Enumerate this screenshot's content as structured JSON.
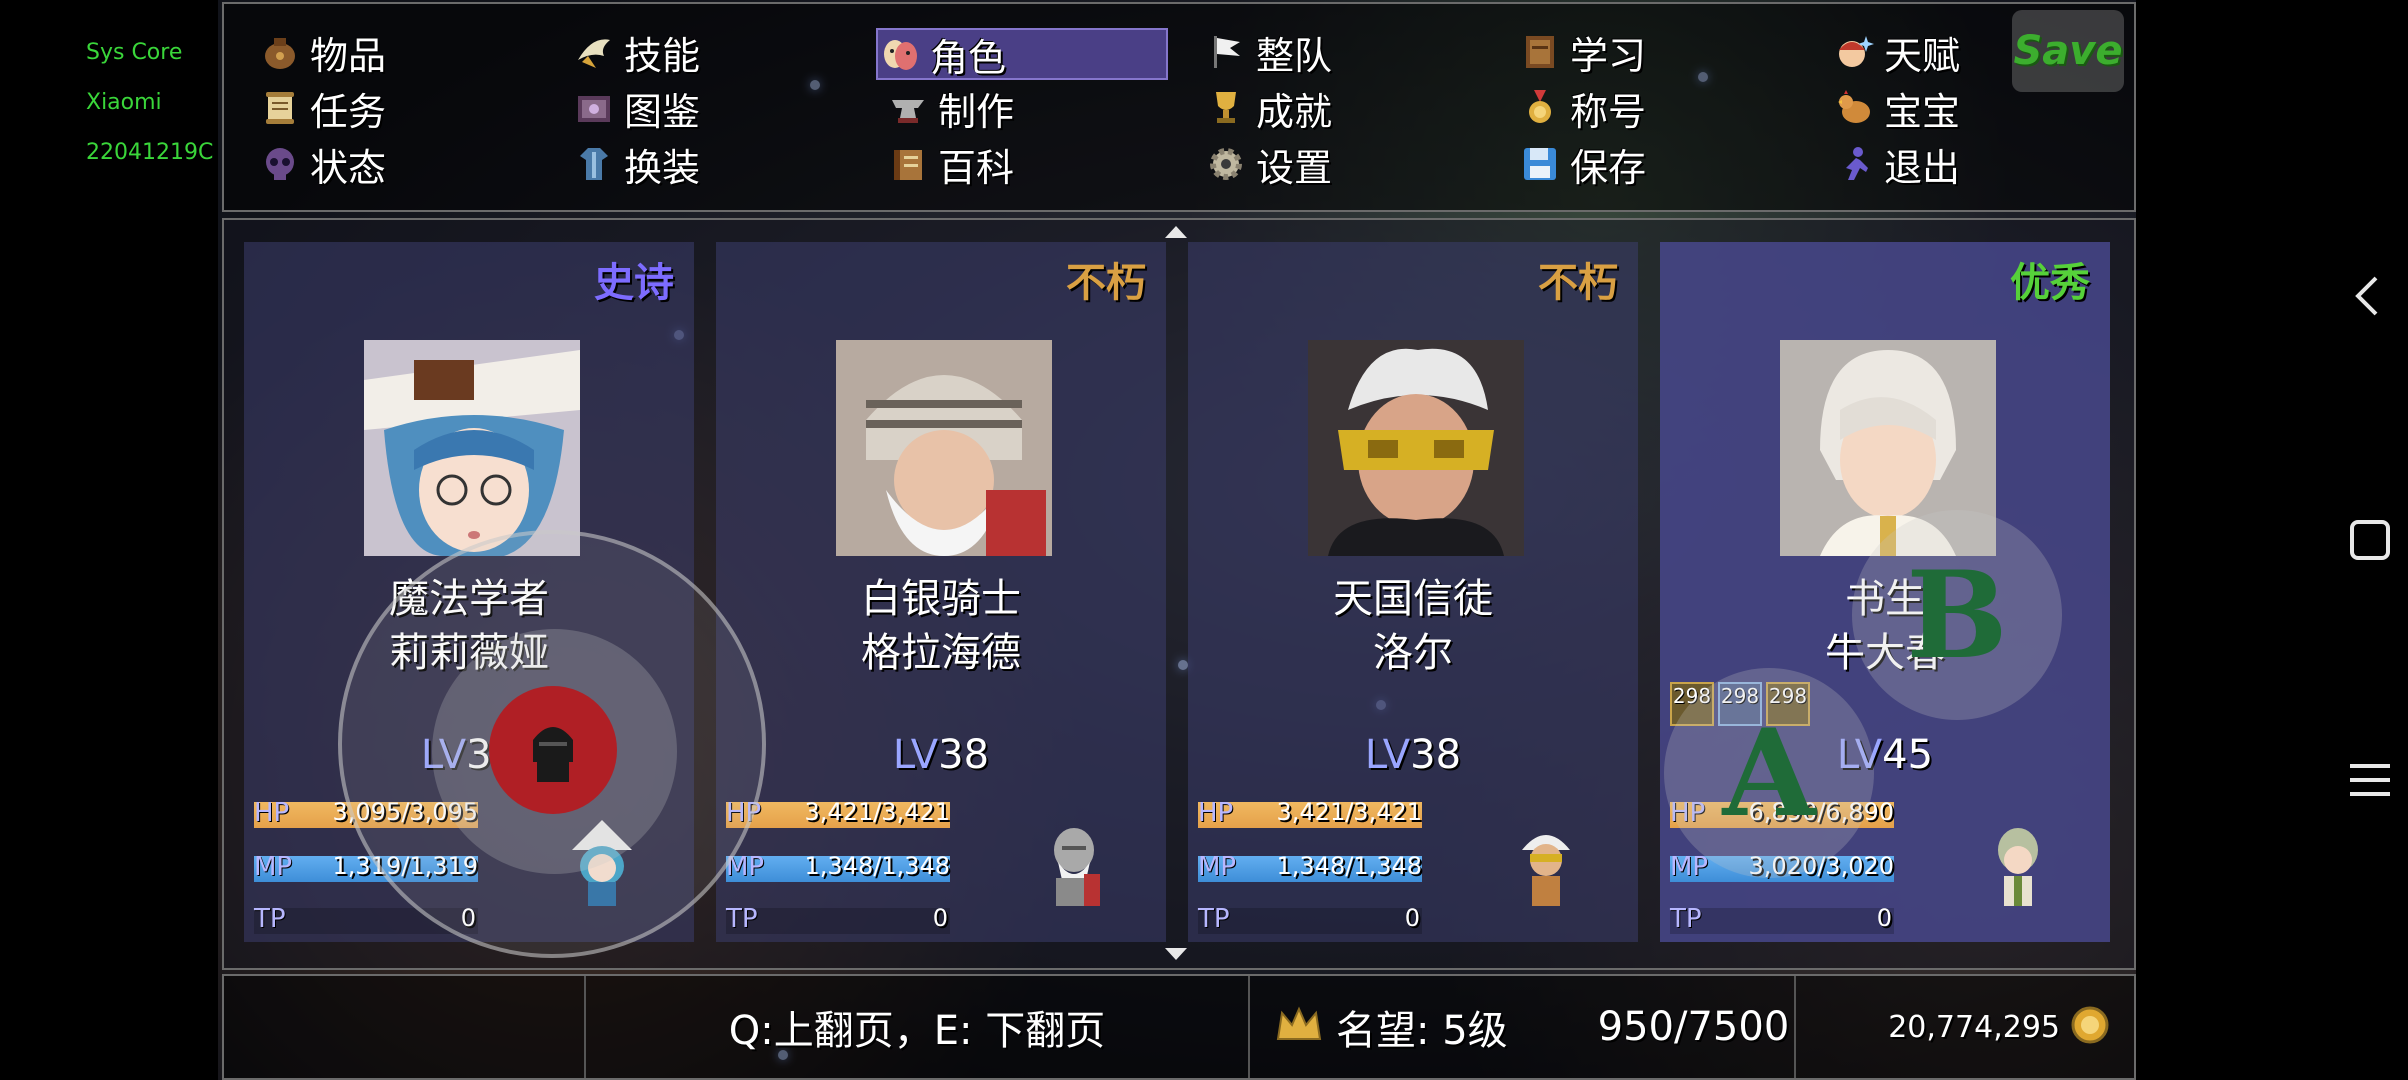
{
  "system_overlay": [
    "Sys Core",
    "Xiaomi",
    "22041219C"
  ],
  "menu": {
    "items": [
      {
        "label": "物品",
        "icon": "bag-icon"
      },
      {
        "label": "技能",
        "icon": "skill-wing-icon"
      },
      {
        "label": "角色",
        "icon": "mask-icon"
      },
      {
        "label": "整队",
        "icon": "flag-icon"
      },
      {
        "label": "学习",
        "icon": "book-icon"
      },
      {
        "label": "天赋",
        "icon": "talent-face-icon"
      },
      {
        "label": "任务",
        "icon": "scroll-icon"
      },
      {
        "label": "图鉴",
        "icon": "catalog-book-icon"
      },
      {
        "label": "制作",
        "icon": "anvil-icon"
      },
      {
        "label": "成就",
        "icon": "trophy-icon"
      },
      {
        "label": "称号",
        "icon": "medal-icon"
      },
      {
        "label": "宝宝",
        "icon": "chicken-icon"
      },
      {
        "label": "状态",
        "icon": "skull-icon"
      },
      {
        "label": "换装",
        "icon": "outfit-icon"
      },
      {
        "label": "百科",
        "icon": "encyclopedia-icon"
      },
      {
        "label": "设置",
        "icon": "gear-icon"
      },
      {
        "label": "保存",
        "icon": "floppy-disk-icon"
      },
      {
        "label": "退出",
        "icon": "exit-runner-icon"
      }
    ],
    "active_index": 2,
    "save_button": "Save"
  },
  "characters": [
    {
      "rarity": "史诗",
      "rarity_color": "#7d6cff",
      "class": "魔法学者",
      "name": "莉莉薇娅",
      "level_prefix": "LV",
      "level": "30",
      "hp": "3,095/3,095",
      "hp_pct": 100,
      "mp": "1,319/1,319",
      "mp_pct": 100,
      "tp": "0",
      "tp_pct": 0,
      "badges": []
    },
    {
      "rarity": "不朽",
      "rarity_color": "#d9a043",
      "class": "白银骑士",
      "name": "格拉海德",
      "level_prefix": "LV",
      "level": "38",
      "hp": "3,421/3,421",
      "hp_pct": 100,
      "mp": "1,348/1,348",
      "mp_pct": 100,
      "tp": "0",
      "tp_pct": 0,
      "badges": []
    },
    {
      "rarity": "不朽",
      "rarity_color": "#d9a043",
      "class": "天国信徒",
      "name": "洛尔",
      "level_prefix": "LV",
      "level": "38",
      "hp": "3,421/3,421",
      "hp_pct": 100,
      "mp": "1,348/1,348",
      "mp_pct": 100,
      "tp": "0",
      "tp_pct": 0,
      "badges": []
    },
    {
      "rarity": "优秀",
      "rarity_color": "#56d13a",
      "class": "书生",
      "name": "牛大春",
      "level_prefix": "LV",
      "level": "45",
      "hp": "6,890/6,890",
      "hp_pct": 100,
      "mp": "3,020/3,020",
      "mp_pct": 100,
      "tp": "0",
      "tp_pct": 0,
      "badges": [
        "298",
        "298",
        "298"
      ]
    }
  ],
  "stat_labels": {
    "hp": "HP",
    "mp": "MP",
    "tp": "TP"
  },
  "bottom": {
    "paging_hint": "Q:上翻页，E: 下翻页",
    "reputation": "名望: 5级",
    "reputation_progress": "950/7500",
    "gold": "20,774,295"
  },
  "touch_controls": {
    "a_label": "A",
    "b_label": "B"
  },
  "colors": {
    "hp_bar": "#e5a14a",
    "mp_bar": "#3e8ed8",
    "tp_bar": "#6060c0",
    "accent_selected": "#4a3f86"
  }
}
